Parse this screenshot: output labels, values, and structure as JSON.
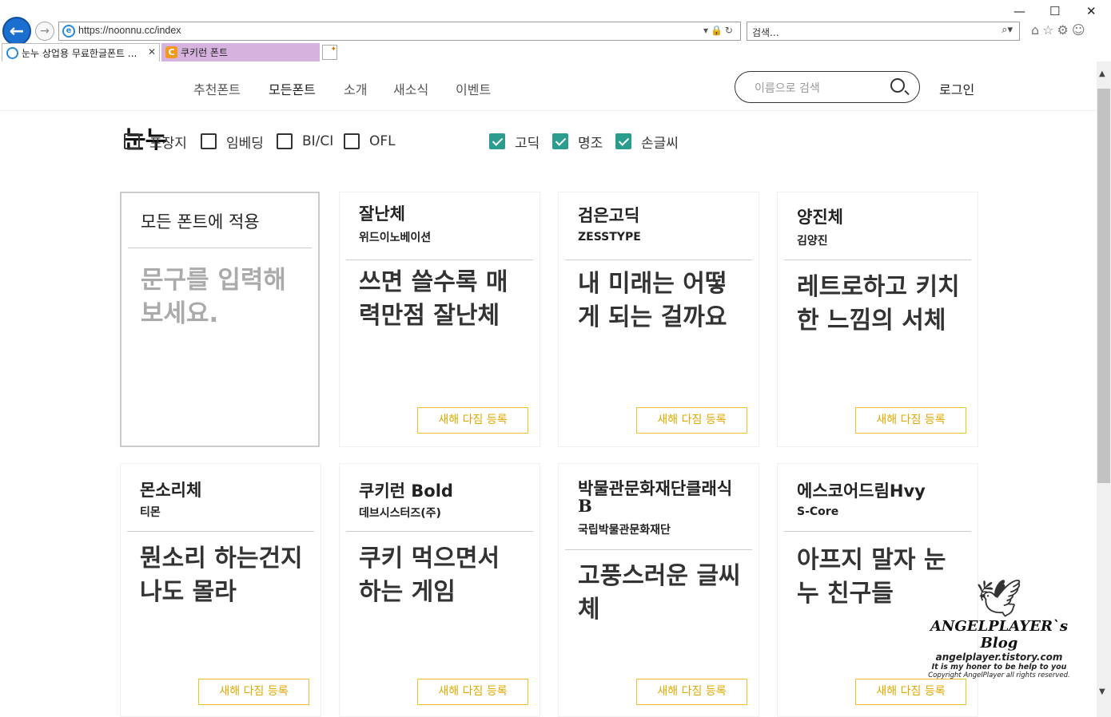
{
  "browser": {
    "url": "https://noonnu.cc/index",
    "search_placeholder": "검색...",
    "tabs": [
      {
        "label": "눈누 상업용 무료한글폰트 ..."
      },
      {
        "label": "쿠키런 폰트"
      }
    ],
    "window_controls": {
      "minimize": "—",
      "maximize": "☐",
      "close": "✕"
    }
  },
  "site": {
    "nav": [
      "추천폰트",
      "모든폰트",
      "소개",
      "새소식",
      "이벤트"
    ],
    "active_nav": "모든폰트",
    "search_placeholder": "이름으로 검색",
    "login": "로그인",
    "logo": "눈누"
  },
  "filters": {
    "left": [
      {
        "label": "포장지",
        "checked": false
      },
      {
        "label": "임베딩",
        "checked": false
      },
      {
        "label": "BI/CI",
        "checked": false
      },
      {
        "label": "OFL",
        "checked": false
      }
    ],
    "right": [
      {
        "label": "고딕",
        "checked": true
      },
      {
        "label": "명조",
        "checked": true
      },
      {
        "label": "손글씨",
        "checked": true
      }
    ],
    "accent": "#2a9d8f"
  },
  "apply_box": {
    "title": "모든 폰트에 적용",
    "placeholder": "문구를 입력해 보세요."
  },
  "register_label": "새해 다짐 등록",
  "cards": [
    {
      "name": "잘난체",
      "maker": "위드이노베이션",
      "sample": "쓰면 쓸수록 매력만점 잘난체"
    },
    {
      "name": "검은고딕",
      "maker": "ZESSTYPE",
      "sample": "내 미래는 어떻게 되는 걸까요"
    },
    {
      "name": "양진체",
      "maker": "김양진",
      "sample": "레트로하고 키치한 느낌의 서체"
    },
    {
      "name": "몬소리체",
      "maker": "티몬",
      "sample": "뭔소리 하는건지 나도 몰라"
    },
    {
      "name": "쿠키런 Bold",
      "maker": "데브시스터즈(주)",
      "sample": "쿠키 먹으면서 하는 게임"
    },
    {
      "name": "박물관문화재단클래식B",
      "maker": "국립박물관문화재단",
      "sample": "고풍스러운 글씨체"
    },
    {
      "name": "에스코어드림Hvy",
      "maker": "S-Core",
      "sample": "아프지 말자 눈누 친구들"
    }
  ],
  "watermark": {
    "title": "ANGELPLAYER`s Blog",
    "url": "angelplayer.tistory.com",
    "line1": "It is my honer to be help to you",
    "line2": "Copyright AngelPlayer all rights reserved."
  }
}
